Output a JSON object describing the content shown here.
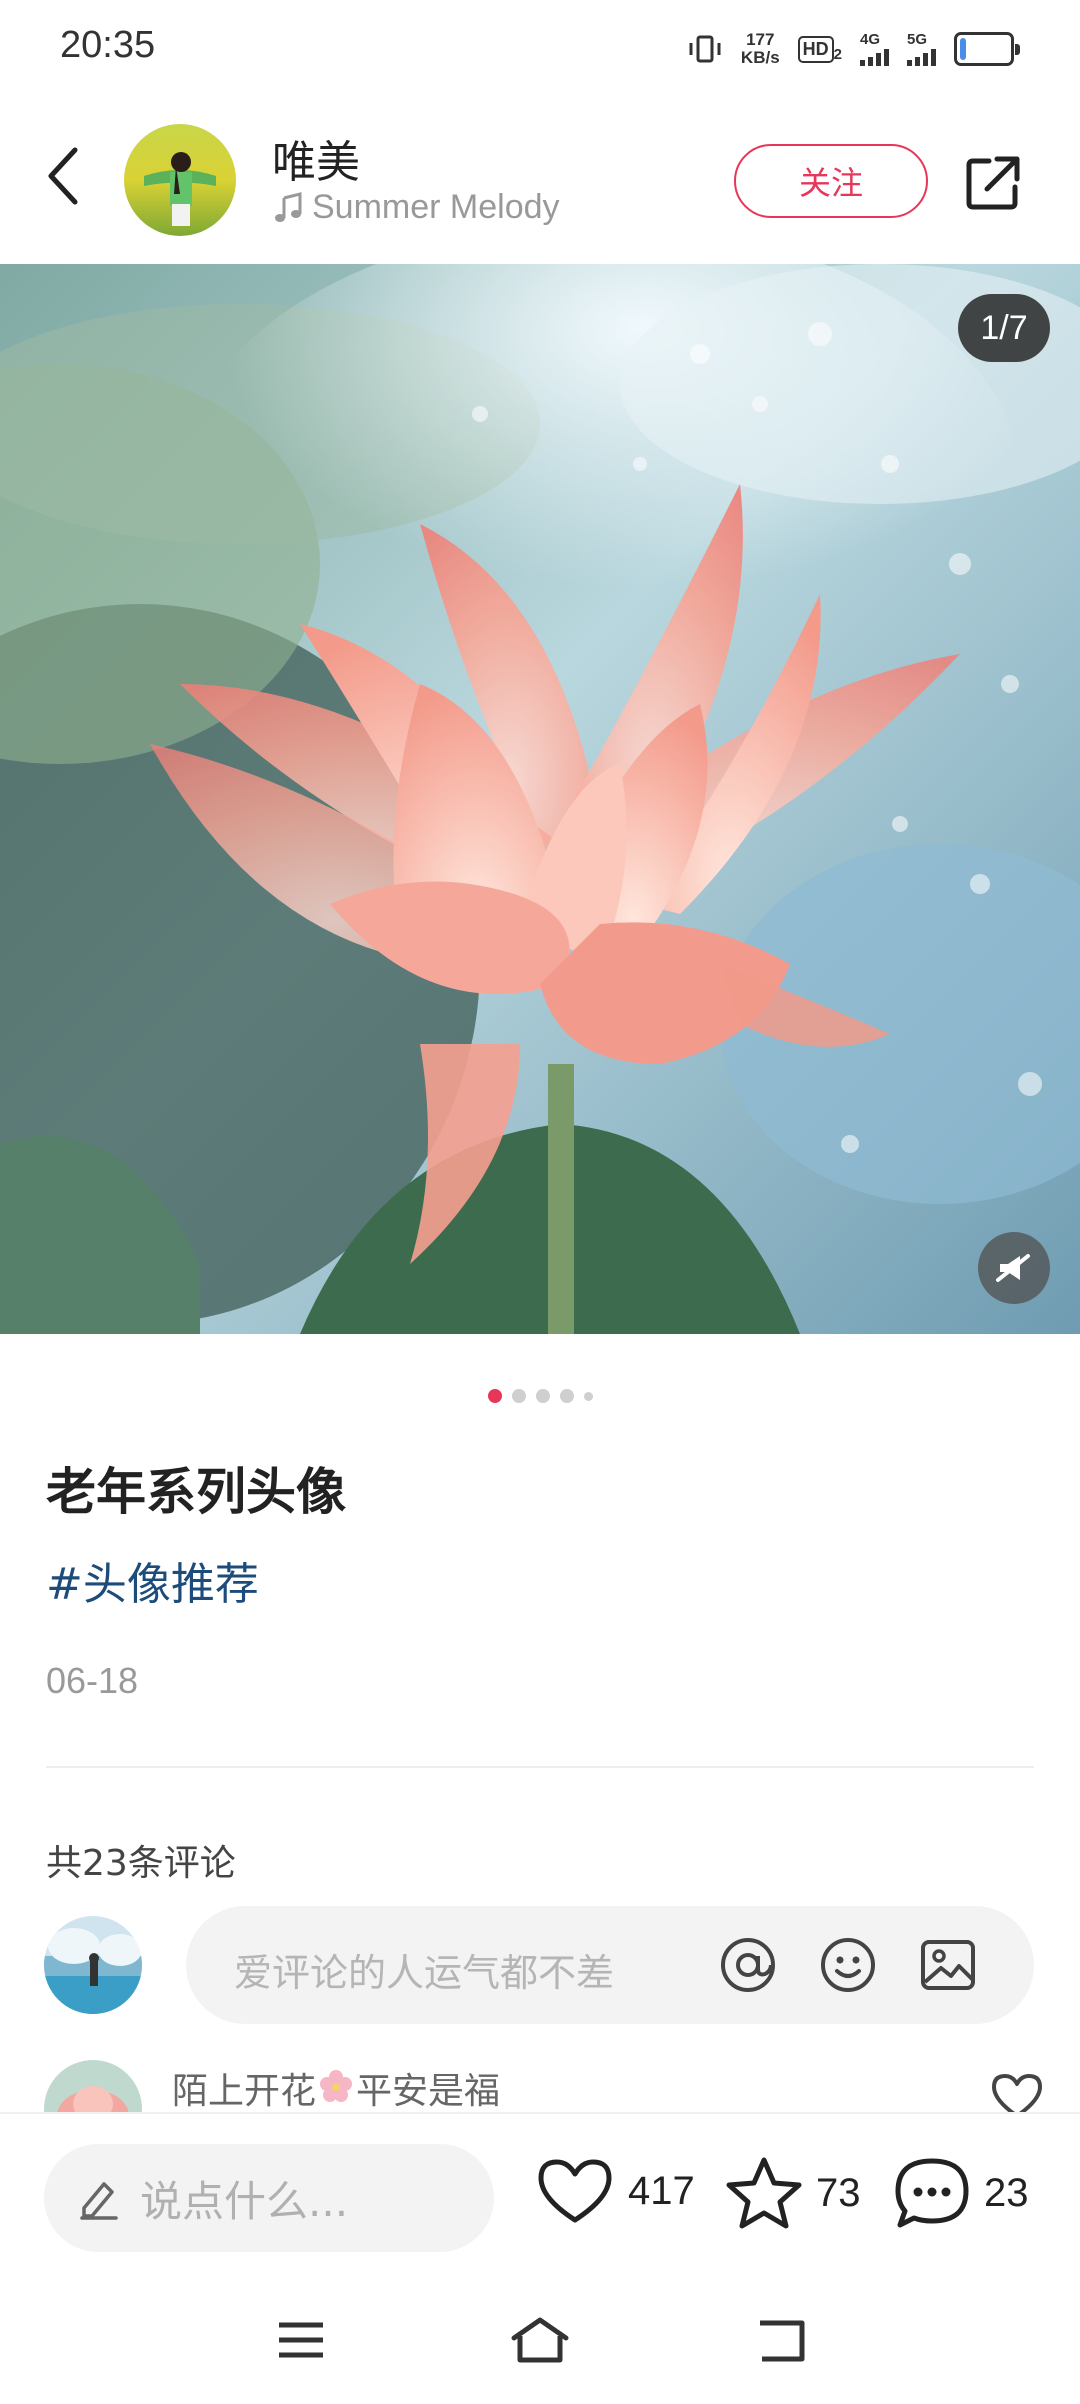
{
  "status_bar": {
    "time": "20:35",
    "net_speed_value": "177",
    "net_speed_unit": "KB/s",
    "hd_label": "HD",
    "hd_sub": "2",
    "sim1_label": "4G",
    "sim2_label": "5G",
    "battery_level": 0.12
  },
  "header": {
    "author_name": "唯美",
    "music_title": "Summer Melody",
    "follow_label": "关注",
    "icons": [
      "back-icon",
      "share-icon",
      "music-note-icon"
    ]
  },
  "photo": {
    "counter": "1/7",
    "mute_icon": "mute-icon",
    "dots_total": 5,
    "dots_active": 0
  },
  "post": {
    "title": "老年系列头像",
    "tag": "#头像推荐",
    "date": "06-18"
  },
  "comments": {
    "count_label": "共23条评论",
    "input_placeholder": "爱评论的人运气都不差",
    "input_icons": [
      "at-icon",
      "emoji-icon",
      "image-icon"
    ],
    "first_comment_name": "陌上开花",
    "first_comment_suffix": "平安是福"
  },
  "bottom_bar": {
    "say_placeholder": "说点什么...",
    "likes": "417",
    "favorites": "73",
    "comments": "23"
  },
  "colors": {
    "accent": "#e8365a",
    "tag": "#1d4c7a",
    "muted": "#999999"
  }
}
